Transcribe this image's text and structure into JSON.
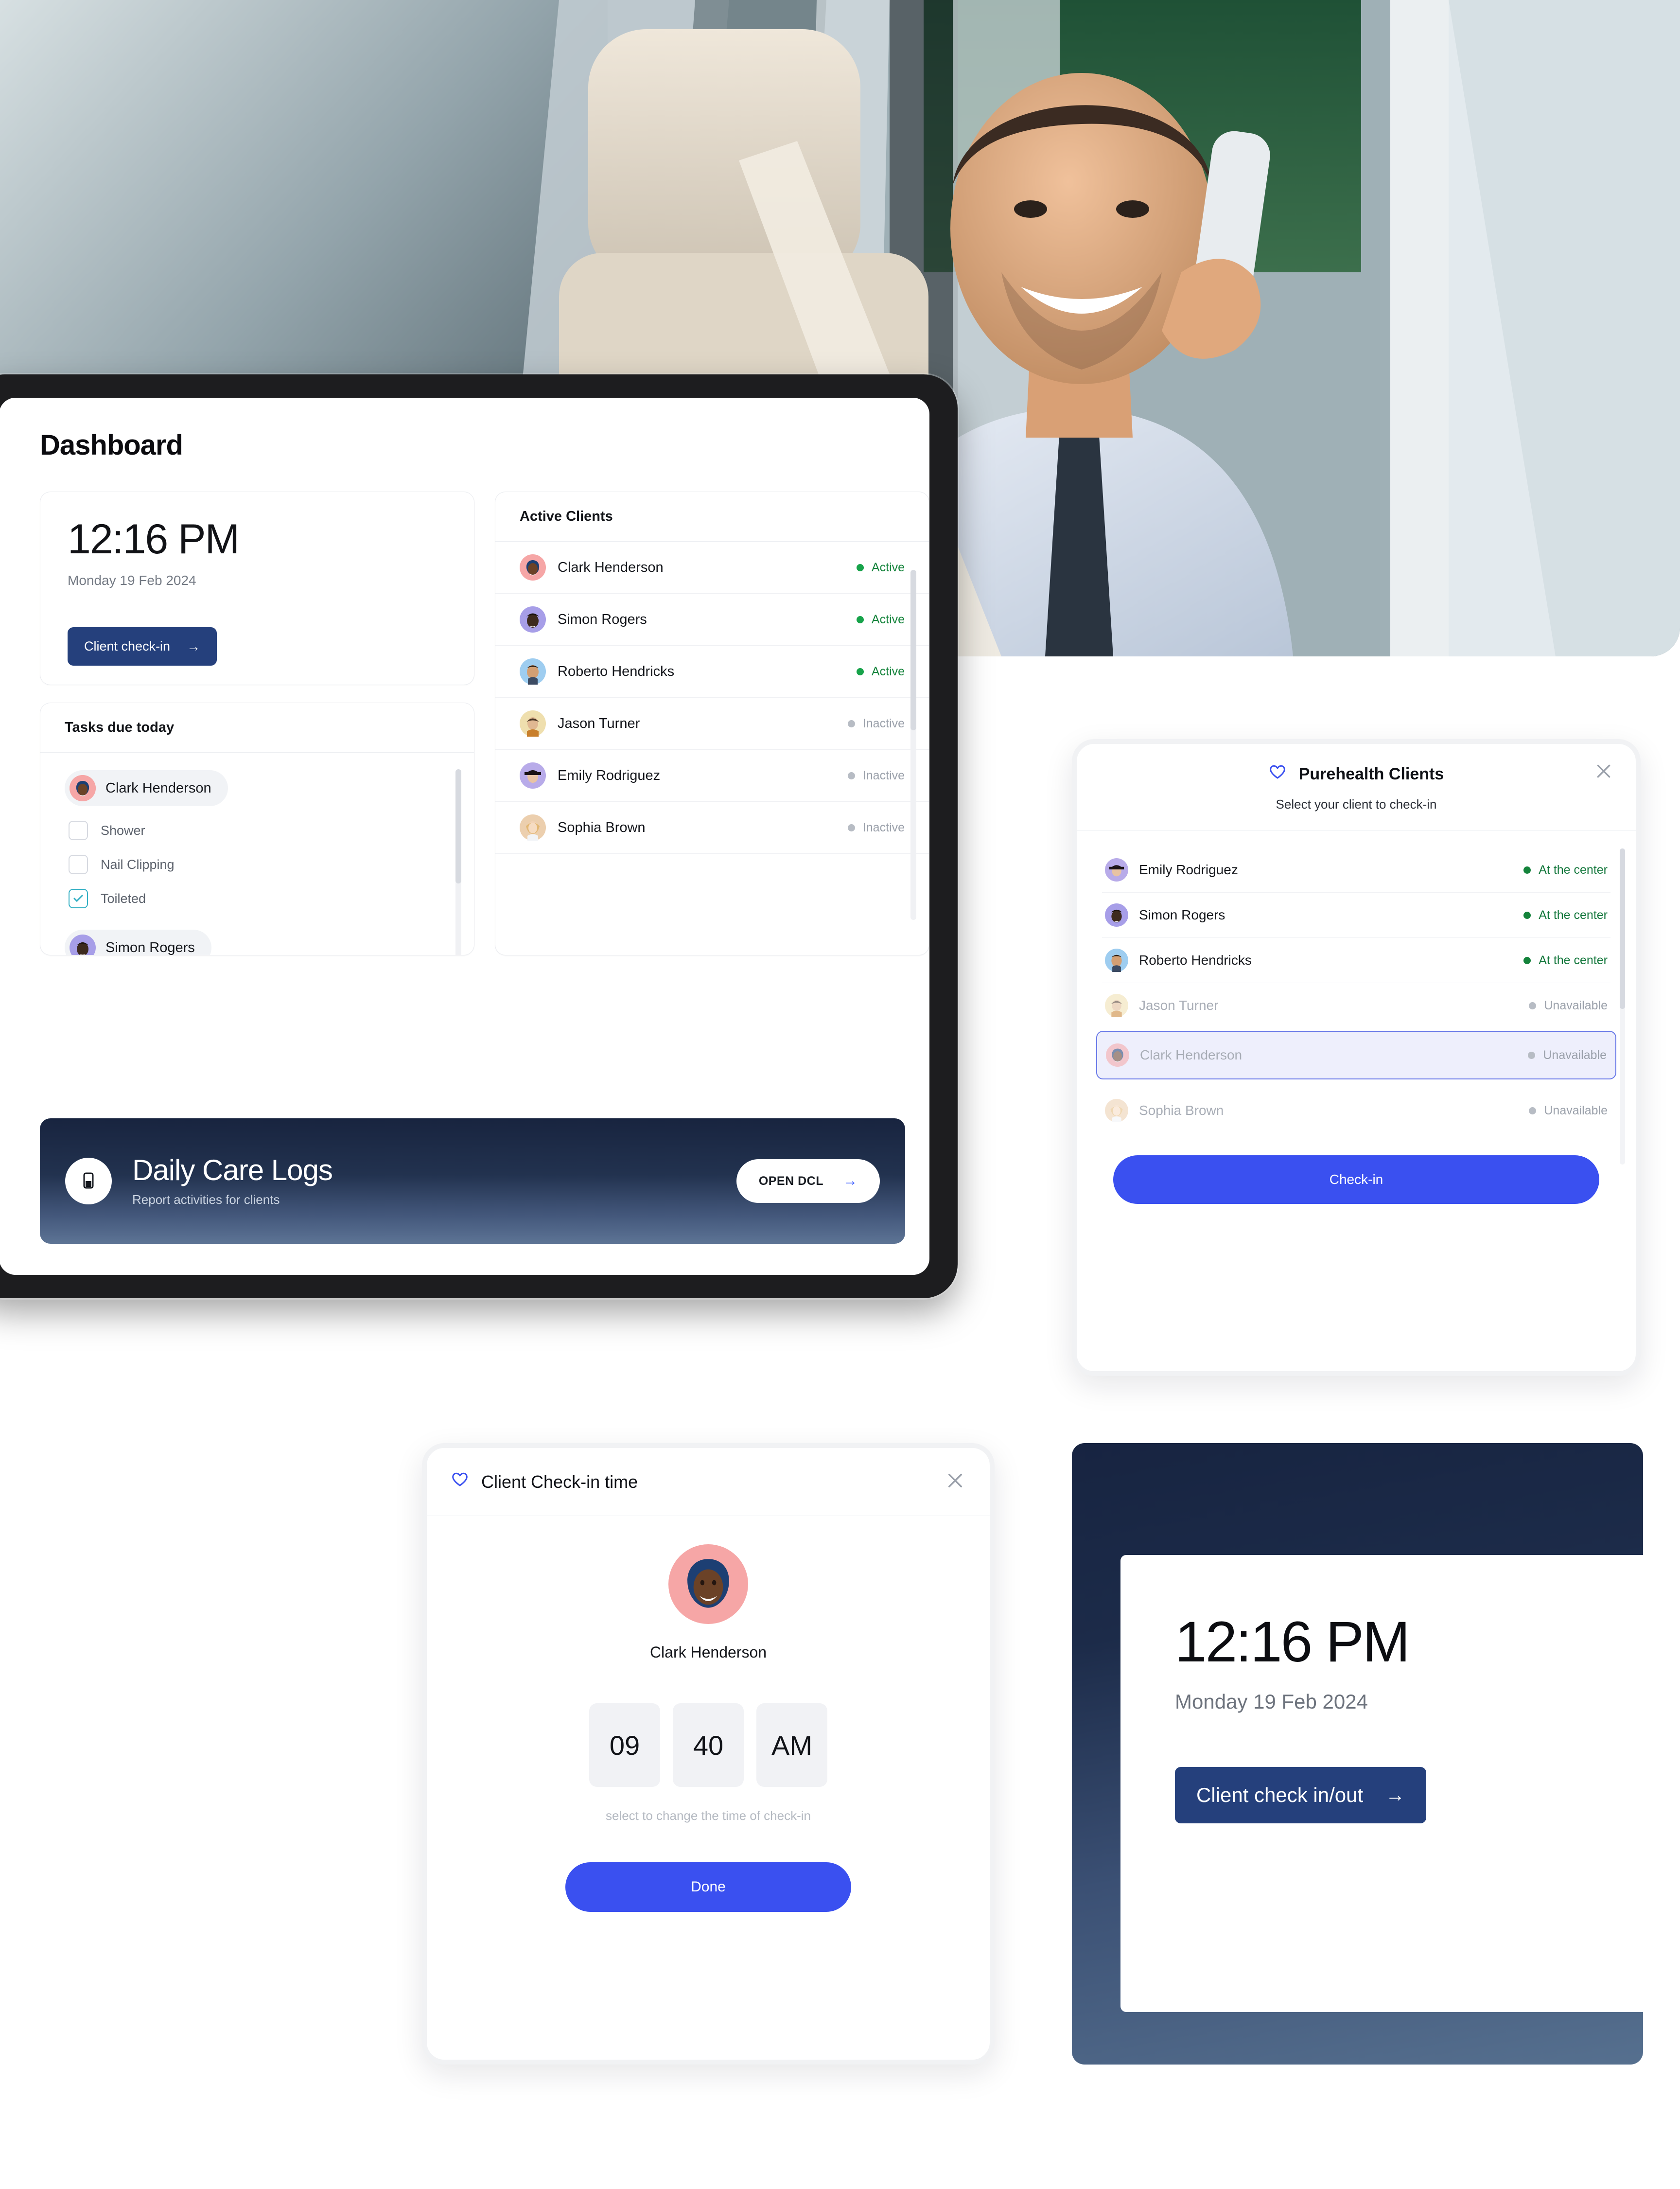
{
  "hero": {
    "alt": "man smiling on phone in car"
  },
  "dashboard": {
    "page_title": "Dashboard",
    "clock": {
      "time": "12:16 PM",
      "date": "Monday 19 Feb 2024",
      "checkin_button": "Client check-in",
      "arrow_icon": "arrow-right-icon"
    },
    "tasks": {
      "header": "Tasks due today",
      "groups": [
        {
          "client": "Clark Henderson",
          "avatar_color": "#f6a6a6",
          "items": [
            {
              "label": "Shower",
              "checked": false
            },
            {
              "label": "Nail Clipping",
              "checked": false
            },
            {
              "label": "Toileted",
              "checked": true
            }
          ]
        },
        {
          "client": "Simon Rogers",
          "avatar_color": "#a79ee8",
          "items": []
        }
      ]
    },
    "clients": {
      "header": "Active Clients",
      "rows": [
        {
          "name": "Clark Henderson",
          "status": "Active",
          "state": "active",
          "avatar_color": "#f6a6a6"
        },
        {
          "name": "Simon Rogers",
          "status": "Active",
          "state": "active",
          "avatar_color": "#a79ee8"
        },
        {
          "name": "Roberto Hendricks",
          "status": "Active",
          "state": "active",
          "avatar_color": "#9ecdf0"
        },
        {
          "name": "Jason Turner",
          "status": "Inactive",
          "state": "inactive",
          "avatar_color": "#efdfae"
        },
        {
          "name": "Emily Rodriguez",
          "status": "Inactive",
          "state": "inactive",
          "avatar_color": "#b8abe9"
        },
        {
          "name": "Sophia Brown",
          "status": "Inactive",
          "state": "inactive",
          "avatar_color": "#eccfae"
        }
      ]
    },
    "dcl_banner": {
      "title": "Daily Care Logs",
      "subtitle": "Report activities for clients",
      "button": "OPEN DCL",
      "icon": "mobile-report-icon",
      "arrow_icon": "arrow-right-icon"
    }
  },
  "purehealth_modal": {
    "title": "Purehealth Clients",
    "subtitle": "Select your client to check-in",
    "heart_icon": "heart-icon",
    "close_icon": "close-icon",
    "rows": [
      {
        "name": "Emily Rodriguez",
        "status": "At the center",
        "state": "at",
        "avatar_color": "#b8abe9",
        "selected": false
      },
      {
        "name": "Simon Rogers",
        "status": "At the center",
        "state": "at",
        "avatar_color": "#a79ee8",
        "selected": false
      },
      {
        "name": "Roberto Hendricks",
        "status": "At the center",
        "state": "at",
        "avatar_color": "#9ecdf0",
        "selected": false
      },
      {
        "name": "Jason Turner",
        "status": "Unavailable",
        "state": "unavailable",
        "avatar_color": "#efdfae",
        "selected": false
      },
      {
        "name": "Clark Henderson",
        "status": "Unavailable",
        "state": "unavailable",
        "avatar_color": "#f6a6a6",
        "selected": true
      },
      {
        "name": "Sophia Brown",
        "status": "Unavailable",
        "state": "unavailable",
        "avatar_color": "#eccfae",
        "selected": false
      }
    ],
    "action_button": "Check-in"
  },
  "checkin_time_modal": {
    "title": "Client Check-in time",
    "heart_icon": "heart-icon",
    "close_icon": "close-icon",
    "client_name": "Clark Henderson",
    "avatar_color": "#f6a6a6",
    "time": {
      "hour": "09",
      "minute": "40",
      "meridiem": "AM"
    },
    "hint": "select to change the time of check-in",
    "done_button": "Done"
  },
  "kiosk_card": {
    "time": "12:16 PM",
    "date": "Monday 19 Feb 2024",
    "button": "Client check in/out",
    "arrow_icon": "arrow-right-icon"
  },
  "colors": {
    "navy": "#25407c",
    "blue": "#3a50f0",
    "green": "#14833b",
    "grey": "#9aa0aa",
    "dark": "#18243f"
  }
}
